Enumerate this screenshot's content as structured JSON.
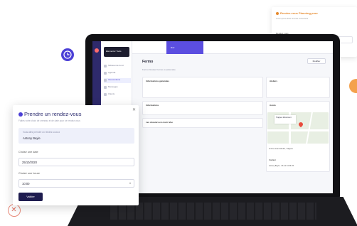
{
  "modal": {
    "title": "Prendre un rendez-vous",
    "subtitle": "Faites votre choix de créneau et de date pour ce rendez-vous",
    "who_label": "Vous allez prendre un rendez-vous à",
    "who_name": "Antony Bayle",
    "date_label": "Choisir une date",
    "date_value": "25/10/2020",
    "hour_label": "Choisir une heure",
    "hour_value": "10:00",
    "submit_label": "Valider"
  },
  "notification": {
    "title": "Rendez-vous Planning pour",
    "subtitle": "Lorem ipsum dolor sit amet consectetur",
    "field_label": "Rendez-vous"
  },
  "app": {
    "brand": "Elementor Tools",
    "tab": "Rdv",
    "page_title": "Fermo",
    "header_button": "Modifier",
    "filter_text": "Fermo   Dossier  Fermo et partenaire",
    "sidebar": [
      "Tableau de bord",
      "Agenda",
      "Interventions",
      "Messages",
      "Clients"
    ],
    "section_a": "Informations générales",
    "section_b": "Informations",
    "section_c": "Ateliers",
    "row_text": "Les dossiers en cours Vue",
    "map_title": "Accès",
    "map_place": "Trappes Monument",
    "address_text": "11 Rue Jean-Moulin, Trappes",
    "contact_title": "Contact",
    "contact_text": "Antony Bayle · 06 12 34 56 78"
  },
  "colors": {
    "accent": "#4b3fd6",
    "dark_button": "#1e1c4f",
    "orange": "#e68a2e"
  }
}
